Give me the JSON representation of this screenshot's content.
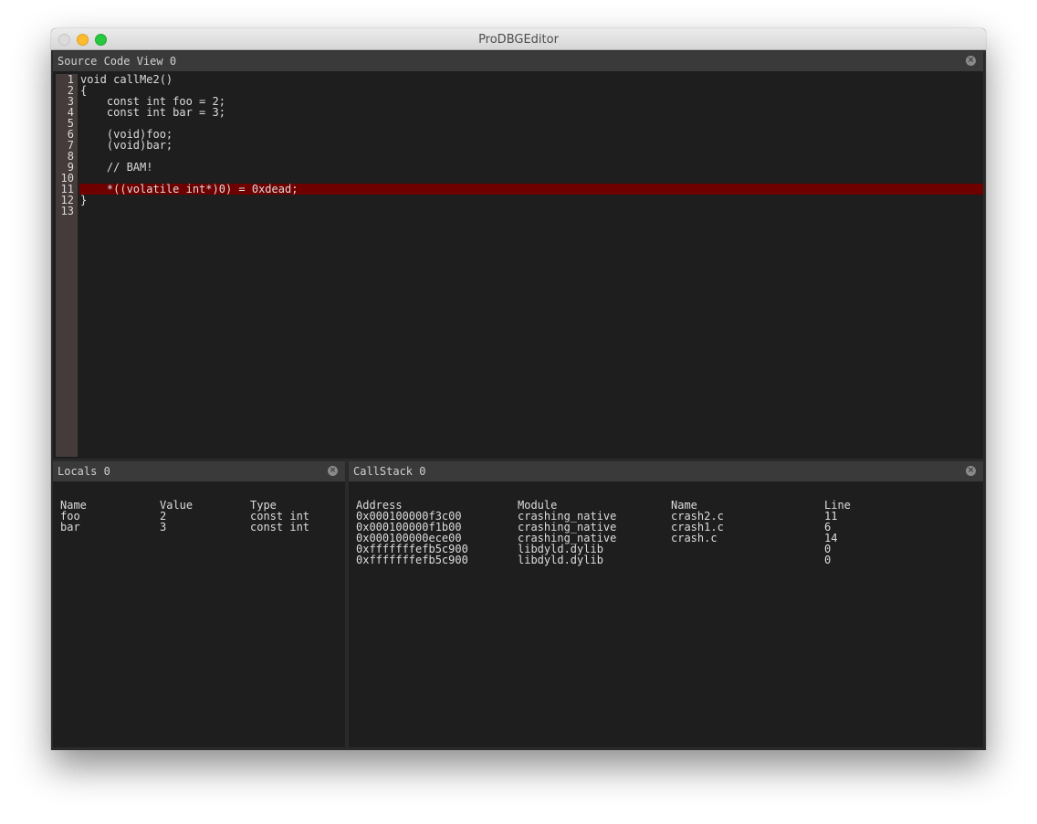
{
  "window": {
    "title": "ProDBGEditor",
    "traffic_lights": [
      "close",
      "minimize",
      "maximize"
    ]
  },
  "source_view": {
    "title": "Source Code View 0",
    "close_icon": "close-circle-icon",
    "highlight_color": "#6e0000",
    "highlighted_line": 11,
    "lines": [
      {
        "n": "1",
        "text": "void callMe2()"
      },
      {
        "n": "2",
        "text": "{"
      },
      {
        "n": "3",
        "text": "    const int foo = 2;"
      },
      {
        "n": "4",
        "text": "    const int bar = 3;"
      },
      {
        "n": "5",
        "text": ""
      },
      {
        "n": "6",
        "text": "    (void)foo;"
      },
      {
        "n": "7",
        "text": "    (void)bar;"
      },
      {
        "n": "8",
        "text": ""
      },
      {
        "n": "9",
        "text": "    // BAM!"
      },
      {
        "n": "10",
        "text": ""
      },
      {
        "n": "11",
        "text": "    *((volatile int*)0) = 0xdead;"
      },
      {
        "n": "12",
        "text": "}"
      },
      {
        "n": "13",
        "text": ""
      }
    ]
  },
  "locals": {
    "title": "Locals 0",
    "close_icon": "close-circle-icon",
    "columns": [
      "Name",
      "Value",
      "Type"
    ],
    "rows": [
      [
        "foo",
        "2",
        "const int"
      ],
      [
        "bar",
        "3",
        "const int"
      ]
    ]
  },
  "callstack": {
    "title": "CallStack 0",
    "close_icon": "close-circle-icon",
    "columns": [
      "Address",
      "Module",
      "Name",
      "Line"
    ],
    "rows": [
      [
        "0x000100000f3c00",
        "crashing_native",
        "crash2.c",
        "11"
      ],
      [
        "0x000100000f1b00",
        "crashing_native",
        "crash1.c",
        "6"
      ],
      [
        "0x000100000ece00",
        "crashing_native",
        "crash.c",
        "14"
      ],
      [
        "0xfffffffefb5c900",
        "libdyld.dylib",
        "",
        "0"
      ],
      [
        "0xfffffffefb5c900",
        "libdyld.dylib",
        "",
        "0"
      ]
    ]
  }
}
